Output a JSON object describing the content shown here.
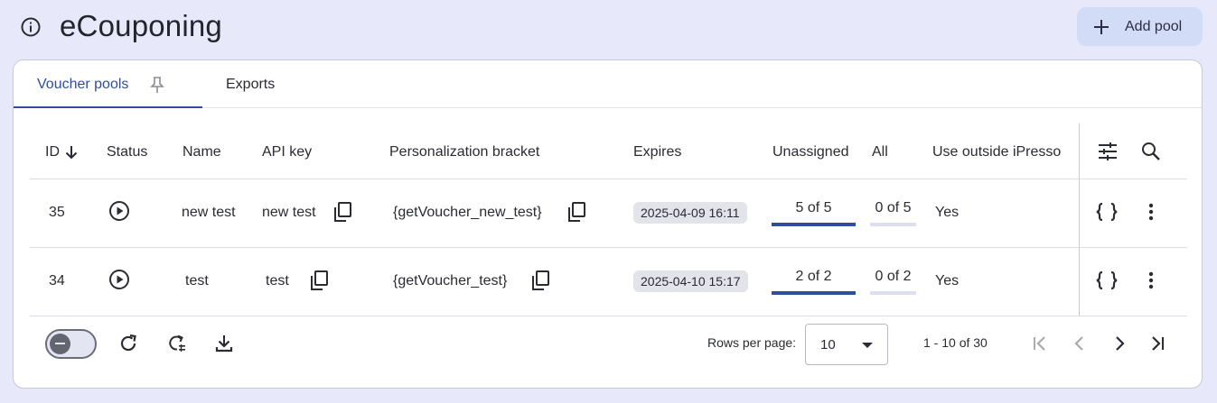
{
  "header": {
    "title": "eCouponing",
    "add_pool_label": "Add pool"
  },
  "tabs": [
    {
      "label": "Voucher pools",
      "active": true
    },
    {
      "label": "Exports",
      "active": false
    }
  ],
  "table": {
    "columns": [
      "ID",
      "Status",
      "Name",
      "API key",
      "Personalization bracket",
      "Expires",
      "Unassigned",
      "All",
      "Use outside iPresso"
    ],
    "sort_column": "ID",
    "sort_direction": "desc",
    "rows": [
      {
        "id": "35",
        "status_icon": "play-circle-icon",
        "name": "new test",
        "api_key": "new test",
        "bracket": "{getVoucher_new_test}",
        "expires": "2025-04-09 16:11",
        "unassigned": "5 of 5",
        "unassigned_fraction": 1.0,
        "all": "0 of 5",
        "all_fraction": 0.0,
        "use_outside": "Yes"
      },
      {
        "id": "34",
        "status_icon": "play-circle-icon",
        "name": "test",
        "api_key": "test",
        "bracket": "{getVoucher_test}",
        "expires": "2025-04-10 15:17",
        "unassigned": "2 of 2",
        "unassigned_fraction": 1.0,
        "all": "0 of 2",
        "all_fraction": 0.0,
        "use_outside": "Yes"
      }
    ]
  },
  "footer": {
    "rows_per_page_label": "Rows per page:",
    "rows_per_page_value": "10",
    "range_text": "1 - 10 of 30"
  },
  "colors": {
    "accent": "#2f4f9a",
    "background": "#e7e9fa",
    "button_bg": "#d3dcf6"
  }
}
